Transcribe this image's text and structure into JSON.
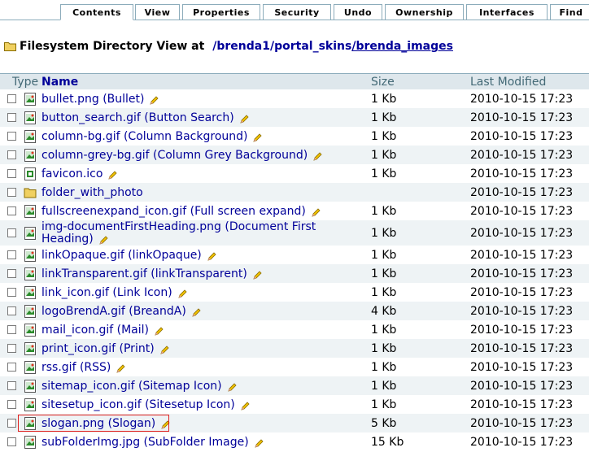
{
  "tabs": [
    "Contents",
    "View",
    "Properties",
    "Security",
    "Undo",
    "Ownership",
    "Interfaces",
    "Find"
  ],
  "title": {
    "label": "Filesystem Directory View at",
    "crumbs": [
      "/brenda1",
      "/portal_skins",
      "/brenda_images"
    ],
    "separators": [
      "/",
      "/"
    ]
  },
  "columns": {
    "type": "Type",
    "name": "Name",
    "size": "Size",
    "modified": "Last Modified"
  },
  "rows": [
    {
      "name": "bullet.png (Bullet)",
      "size": "1 Kb",
      "modified": "2010-10-15 17:23",
      "icon": "image-icon",
      "editable": true
    },
    {
      "name": "button_search.gif (Button Search)",
      "size": "1 Kb",
      "modified": "2010-10-15 17:23",
      "icon": "image-icon",
      "editable": true
    },
    {
      "name": "column-bg.gif (Column Background)",
      "size": "1 Kb",
      "modified": "2010-10-15 17:23",
      "icon": "image-icon",
      "editable": true
    },
    {
      "name": "column-grey-bg.gif (Column Grey Background)",
      "size": "1 Kb",
      "modified": "2010-10-15 17:23",
      "icon": "image-icon",
      "editable": true
    },
    {
      "name": "favicon.ico",
      "size": "1 Kb",
      "modified": "2010-10-15 17:23",
      "icon": "file-icon",
      "editable": true
    },
    {
      "name": "folder_with_photo",
      "size": "",
      "modified": "2010-10-15 17:23",
      "icon": "folder-icon",
      "editable": false
    },
    {
      "name": "fullscreenexpand_icon.gif (Full screen expand)",
      "size": "1 Kb",
      "modified": "2010-10-15 17:23",
      "icon": "image-icon",
      "editable": true
    },
    {
      "name": "img-documentFirstHeading.png (Document First Heading)",
      "size": "1 Kb",
      "modified": "2010-10-15 17:23",
      "icon": "image-icon",
      "editable": true
    },
    {
      "name": "linkOpaque.gif (linkOpaque)",
      "size": "1 Kb",
      "modified": "2010-10-15 17:23",
      "icon": "image-icon",
      "editable": true
    },
    {
      "name": "linkTransparent.gif (linkTransparent)",
      "size": "1 Kb",
      "modified": "2010-10-15 17:23",
      "icon": "image-icon",
      "editable": true
    },
    {
      "name": "link_icon.gif (Link Icon)",
      "size": "1 Kb",
      "modified": "2010-10-15 17:23",
      "icon": "image-icon",
      "editable": true
    },
    {
      "name": "logoBrendA.gif (BreandA)",
      "size": "4 Kb",
      "modified": "2010-10-15 17:23",
      "icon": "image-icon",
      "editable": true
    },
    {
      "name": "mail_icon.gif (Mail)",
      "size": "1 Kb",
      "modified": "2010-10-15 17:23",
      "icon": "image-icon",
      "editable": true
    },
    {
      "name": "print_icon.gif (Print)",
      "size": "1 Kb",
      "modified": "2010-10-15 17:23",
      "icon": "image-icon",
      "editable": true
    },
    {
      "name": "rss.gif (RSS)",
      "size": "1 Kb",
      "modified": "2010-10-15 17:23",
      "icon": "image-icon",
      "editable": true
    },
    {
      "name": "sitemap_icon.gif (Sitemap Icon)",
      "size": "1 Kb",
      "modified": "2010-10-15 17:23",
      "icon": "image-icon",
      "editable": true
    },
    {
      "name": "sitesetup_icon.gif (Sitesetup Icon)",
      "size": "1 Kb",
      "modified": "2010-10-15 17:23",
      "icon": "image-icon",
      "editable": true
    },
    {
      "name": "slogan.png (Slogan)",
      "size": "5 Kb",
      "modified": "2010-10-15 17:23",
      "icon": "image-icon",
      "editable": true,
      "highlighted": true
    },
    {
      "name": "subFolderImg.jpg (SubFolder Image)",
      "size": "15 Kb",
      "modified": "2010-10-15 17:23",
      "icon": "image-icon",
      "editable": true
    }
  ],
  "colors": {
    "link": "#000099",
    "header_bg": "#dee7ec",
    "row_alt": "#eef3f5",
    "border": "#8cacbb",
    "highlight": "#e0201e"
  }
}
